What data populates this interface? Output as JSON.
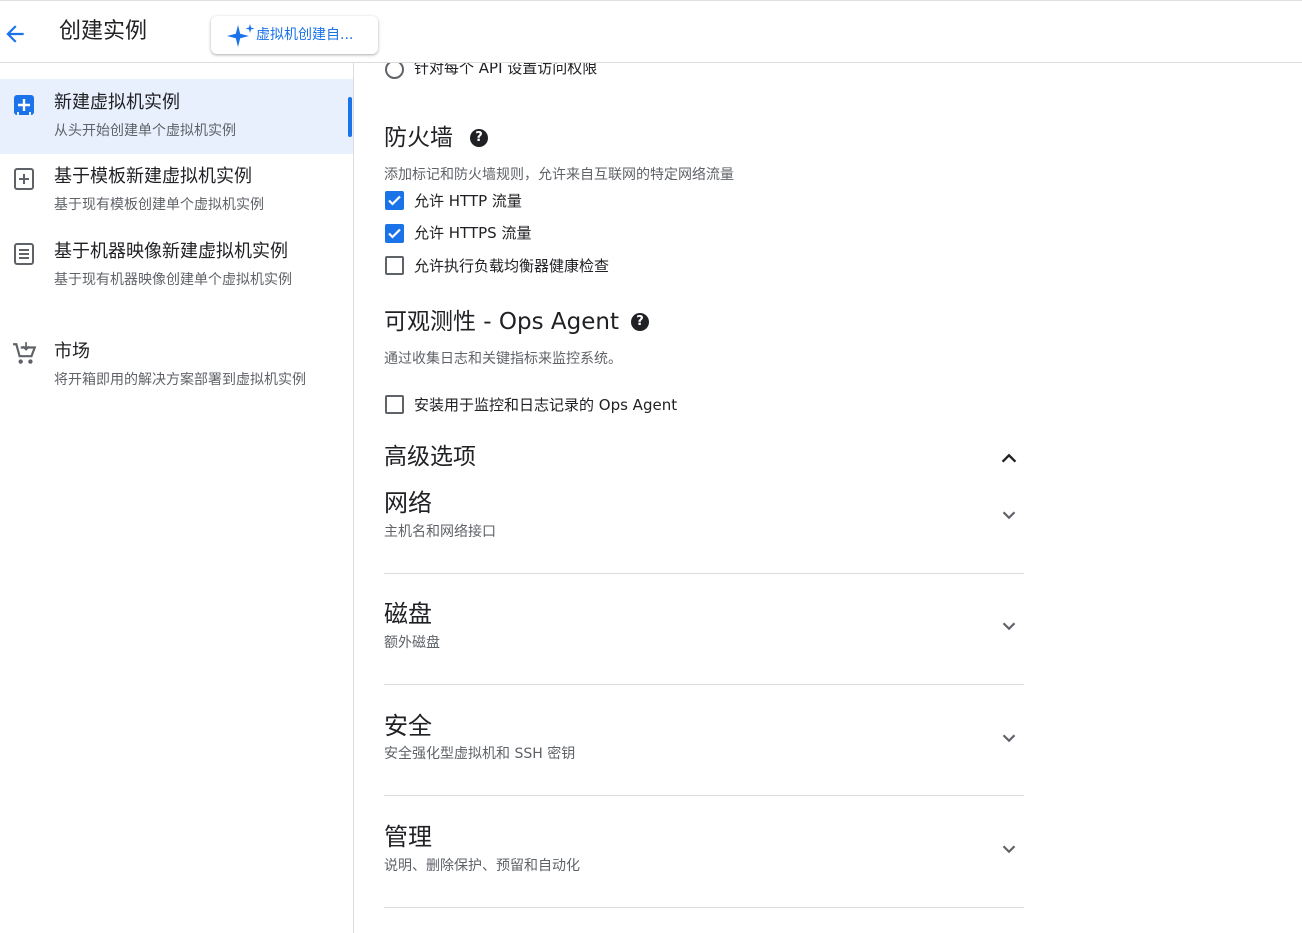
{
  "header": {
    "title": "创建实例",
    "ai_chip_label": "虚拟机创建自..."
  },
  "sidebar": {
    "items": [
      {
        "title": "新建虚拟机实例",
        "subtitle": "从头开始创建单个虚拟机实例",
        "active": true,
        "icon": "add-box-icon"
      },
      {
        "title": "基于模板新建虚拟机实例",
        "subtitle": "基于现有模板创建单个虚拟机实例",
        "active": false,
        "icon": "template-icon"
      },
      {
        "title": "基于机器映像新建虚拟机实例",
        "subtitle": "基于现有机器映像创建单个虚拟机实例",
        "active": false,
        "icon": "machine-image-icon"
      },
      {
        "title": "市场",
        "subtitle": "将开箱即用的解决方案部署到虚拟机实例",
        "active": false,
        "icon": "cart-icon"
      }
    ]
  },
  "main": {
    "api_access_option": "针对每个 API 设置访问权限",
    "firewall": {
      "title": "防火墙",
      "description": "添加标记和防火墙规则，允许来自互联网的特定网络流量",
      "options": [
        {
          "label": "允许 HTTP 流量",
          "checked": true
        },
        {
          "label": "允许 HTTPS 流量",
          "checked": true
        },
        {
          "label": "允许执行负载均衡器健康检查",
          "checked": false
        }
      ]
    },
    "observability": {
      "title": "可观测性 - Ops Agent",
      "description": "通过收集日志和关键指标来监控系统。",
      "option": {
        "label": "安装用于监控和日志记录的 Ops Agent",
        "checked": false
      }
    },
    "advanced": {
      "title": "高级选项",
      "sections": [
        {
          "title": "网络",
          "subtitle": "主机名和网络接口"
        },
        {
          "title": "磁盘",
          "subtitle": "额外磁盘"
        },
        {
          "title": "安全",
          "subtitle": "安全强化型虚拟机和 SSH 密钥"
        },
        {
          "title": "管理",
          "subtitle": "说明、删除保护、预留和自动化"
        }
      ]
    }
  },
  "colors": {
    "accent": "#1a73e8",
    "active_bg": "#e8f0fe",
    "divider": "#dadce0",
    "secondary_text": "#5f6368"
  }
}
